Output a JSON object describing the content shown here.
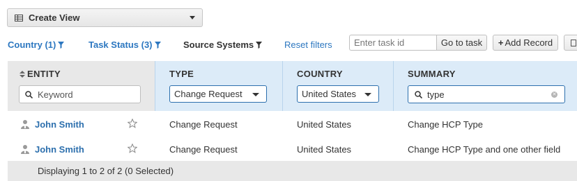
{
  "toolbar": {
    "create_view_label": "Create View",
    "task_input_placeholder": "Enter task id",
    "go_to_task_label": "Go to task",
    "add_record_label": "Add Record"
  },
  "filters": {
    "country": "Country (1)",
    "task_status": "Task Status (3)",
    "source_systems": "Source Systems",
    "reset": "Reset filters"
  },
  "columns": {
    "entity": {
      "title": "ENTITY",
      "placeholder": "Keyword"
    },
    "type": {
      "title": "TYPE",
      "selected": "Change Request"
    },
    "country": {
      "title": "COUNTRY",
      "selected": "United States"
    },
    "summary": {
      "title": "SUMMARY",
      "search_value": "type"
    }
  },
  "rows": [
    {
      "entity": "John Smith",
      "type": "Change Request",
      "country": "United States",
      "summary": "Change HCP Type"
    },
    {
      "entity": "John Smith",
      "type": "Change Request",
      "country": "United States",
      "summary": "Change HCP Type and one other field"
    }
  ],
  "footer": {
    "status": "Displaying 1 to 2 of 2 (0 Selected)"
  },
  "colors": {
    "link": "#2c77c0",
    "selected_header": "#dcebf8",
    "header_gray": "#e8e8e8"
  }
}
